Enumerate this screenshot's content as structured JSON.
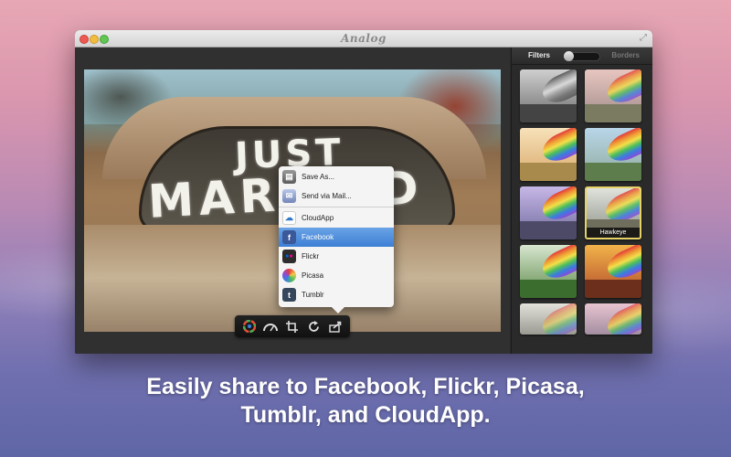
{
  "window": {
    "title": "Analog"
  },
  "toolbar": {
    "icons": [
      "color-wheel-icon",
      "exposure-icon",
      "crop-icon",
      "rotate-icon",
      "share-icon"
    ]
  },
  "share_menu": {
    "items": [
      {
        "label": "Save As...",
        "icon": "save-icon"
      },
      {
        "label": "Send via Mail...",
        "icon": "mail-icon"
      },
      {
        "label": "CloudApp",
        "icon": "cloudapp-icon"
      },
      {
        "label": "Facebook",
        "icon": "facebook-icon",
        "selected": true
      },
      {
        "label": "Flickr",
        "icon": "flickr-icon"
      },
      {
        "label": "Picasa",
        "icon": "picasa-icon"
      },
      {
        "label": "Tumblr",
        "icon": "tumblr-icon"
      }
    ]
  },
  "photo": {
    "painted_text_line1": "JUST",
    "painted_text_line2": "MARRIED"
  },
  "panel": {
    "tab_filters": "Filters",
    "tab_borders": "Borders",
    "selected_filter": "Hawkeye"
  },
  "caption": {
    "line1": "Easily share to Facebook, Flickr, Picasa,",
    "line2": "Tumblr, and CloudApp."
  },
  "colors": {
    "menu_selected": "#3d7fd4",
    "thumb_selected_border": "#e5d36a"
  }
}
